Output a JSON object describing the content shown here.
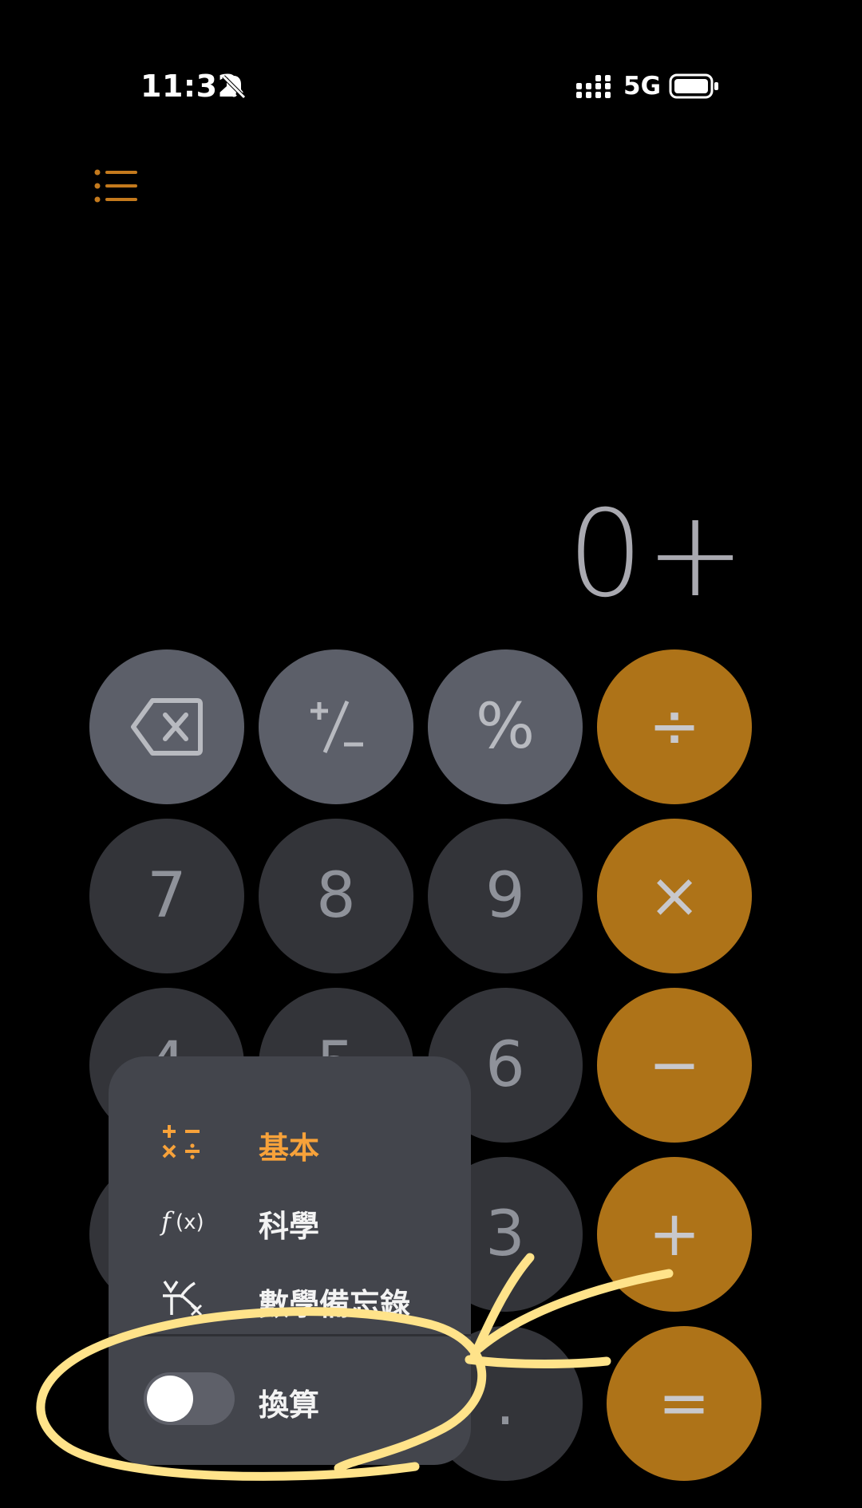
{
  "status": {
    "time": "11:32",
    "network": "5G"
  },
  "display": {
    "value": "0+"
  },
  "keys": {
    "backspace": "backspace",
    "sign": "+/−",
    "percent": "%",
    "divide": "÷",
    "seven": "7",
    "eight": "8",
    "nine": "9",
    "multiply": "×",
    "four": "4",
    "five": "5",
    "six": "6",
    "minus": "−",
    "three": "3",
    "plus": "+",
    "decimal": ".",
    "equals": "="
  },
  "menu": {
    "items": [
      {
        "label": "基本",
        "icon": "basic-operators-icon",
        "active": true
      },
      {
        "label": "科學",
        "icon": "function-icon",
        "active": false
      },
      {
        "label": "數學備忘錄",
        "icon": "math-notes-icon",
        "active": false
      }
    ],
    "convert_label": "換算",
    "convert_enabled": false
  },
  "colors": {
    "accent": "#f7a23a",
    "operator": "#ae7318",
    "function_key": "#5c5f69",
    "number_key": "#333439",
    "annotation": "#ffe38a"
  }
}
